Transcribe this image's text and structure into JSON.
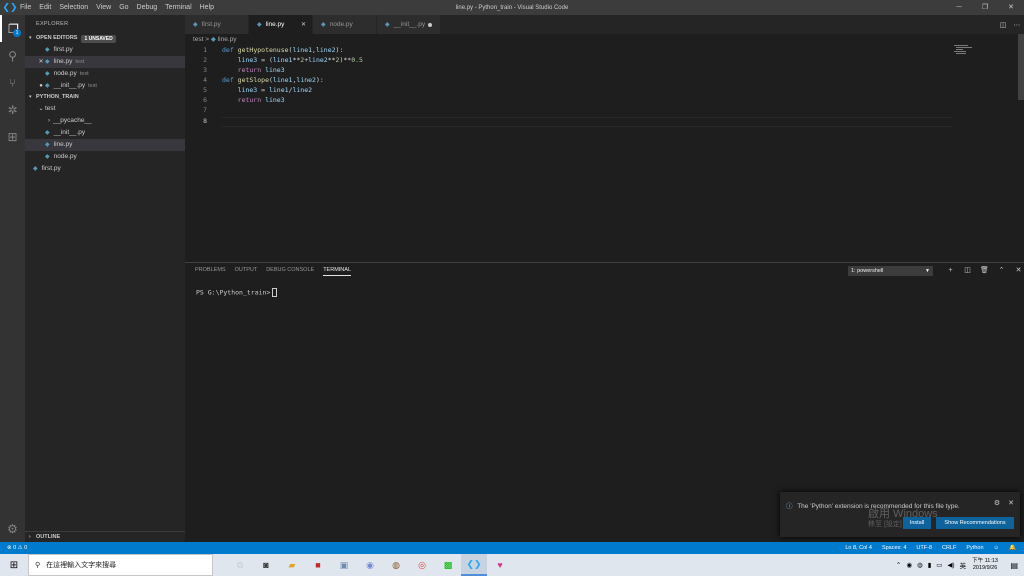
{
  "titlebar": {
    "menu": [
      "File",
      "Edit",
      "Selection",
      "View",
      "Go",
      "Debug",
      "Terminal",
      "Help"
    ],
    "title": "line.py - Python_train - Visual Studio Code"
  },
  "sidebar": {
    "header": "EXPLORER",
    "open_editors": {
      "label": "OPEN EDITORS",
      "badge": "1 UNSAVED",
      "items": [
        {
          "name": "first.py",
          "desc": ""
        },
        {
          "name": "line.py",
          "desc": "test"
        },
        {
          "name": "node.py",
          "desc": "test"
        },
        {
          "name": "__init__.py",
          "desc": "test"
        }
      ]
    },
    "folder": {
      "label": "PYTHON_TRAIN",
      "items": [
        "test",
        "__pycache__",
        "__init__.py",
        "line.py",
        "node.py",
        "first.py"
      ]
    },
    "outline": "OUTLINE"
  },
  "tabs": [
    {
      "label": "first.py"
    },
    {
      "label": "line.py"
    },
    {
      "label": "node.py"
    },
    {
      "label": "__init__.py"
    }
  ],
  "breadcrumb": {
    "folder": "test",
    "sep": ">",
    "file": "line.py"
  },
  "editor": {
    "line_numbers": [
      "1",
      "2",
      "3",
      "4",
      "5",
      "6",
      "7",
      "8"
    ],
    "lines": [
      "def getHypotenuse(line1,line2):",
      "    line3 = (line1**2+line2**2)**0.5",
      "    return line3",
      "def getSlope(line1,line2):",
      "    line3 = line1/line2",
      "    return line3",
      "",
      ""
    ]
  },
  "panel": {
    "tabs": [
      "PROBLEMS",
      "OUTPUT",
      "DEBUG CONSOLE",
      "TERMINAL"
    ],
    "terminal_select": "1: powershell",
    "prompt": "PS G:\\Python_train>"
  },
  "notification": {
    "message": "The 'Python' extension is recommended for this file type.",
    "install": "Install",
    "show": "Show Recommendations",
    "watermark_line1": "啟用 Windows",
    "watermark_line2": "移至 [設定]"
  },
  "statusbar": {
    "errors": "⊗ 0 ⚠ 0",
    "position": "Ln 8, Col 4",
    "spaces": "Spaces: 4",
    "encoding": "UTF-8",
    "eol": "CRLF",
    "language": "Python"
  },
  "taskbar": {
    "search_placeholder": "在這裡輸入文字來搜尋",
    "ime": "英",
    "time": "下午 11:13",
    "date": "2019/9/26"
  }
}
